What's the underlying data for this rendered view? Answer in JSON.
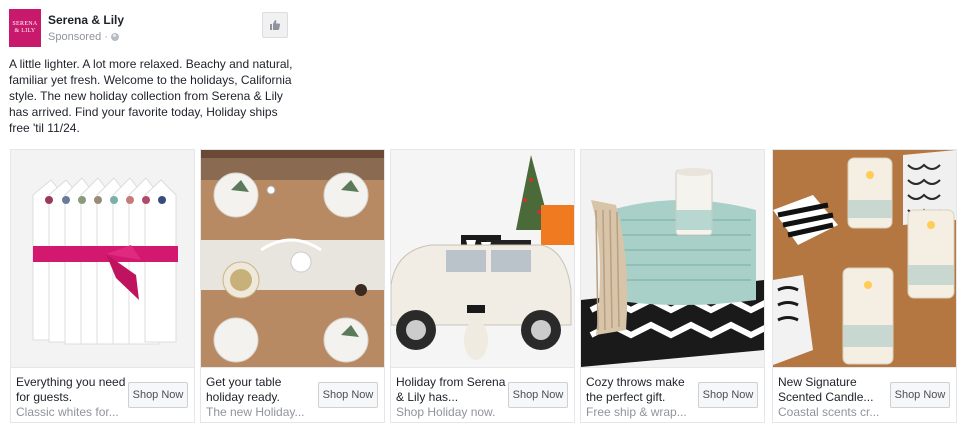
{
  "post": {
    "page_name": "Serena & Lily",
    "logo_line1": "SERENA",
    "logo_line2": "& LILY",
    "sponsored_label": "Sponsored ·",
    "text": "A little lighter. A lot more relaxed. Beachy and natural, familiar yet fresh. Welcome to the holidays, California style. The new holiday collection from Serena & Lily has arrived. Find your favorite today, Holiday ships free 'til 11/24.",
    "brand_color": "#c8196c"
  },
  "cards": [
    {
      "title": "Everything you need for guests.",
      "description": "Classic whites for...",
      "cta": "Shop Now",
      "image": "napkins-with-pink-ribbon"
    },
    {
      "title": "Get your table holiday ready.",
      "description": "The new Holiday...",
      "cta": "Shop Now",
      "image": "holiday-table-setting"
    },
    {
      "title": "Holiday from Serena & Lily has...",
      "description": "Shop Holiday now.",
      "cta": "Shop Now",
      "image": "white-car-with-tree-and-dog"
    },
    {
      "title": "Cozy throws make the perfect gift.",
      "description": "Free ship & wrap...",
      "cta": "Shop Now",
      "image": "throw-blanket-and-candle"
    },
    {
      "title": "New Signature Scented Candle...",
      "description": "Coastal scents cr...",
      "cta": "Shop Now",
      "image": "scented-candles"
    }
  ]
}
